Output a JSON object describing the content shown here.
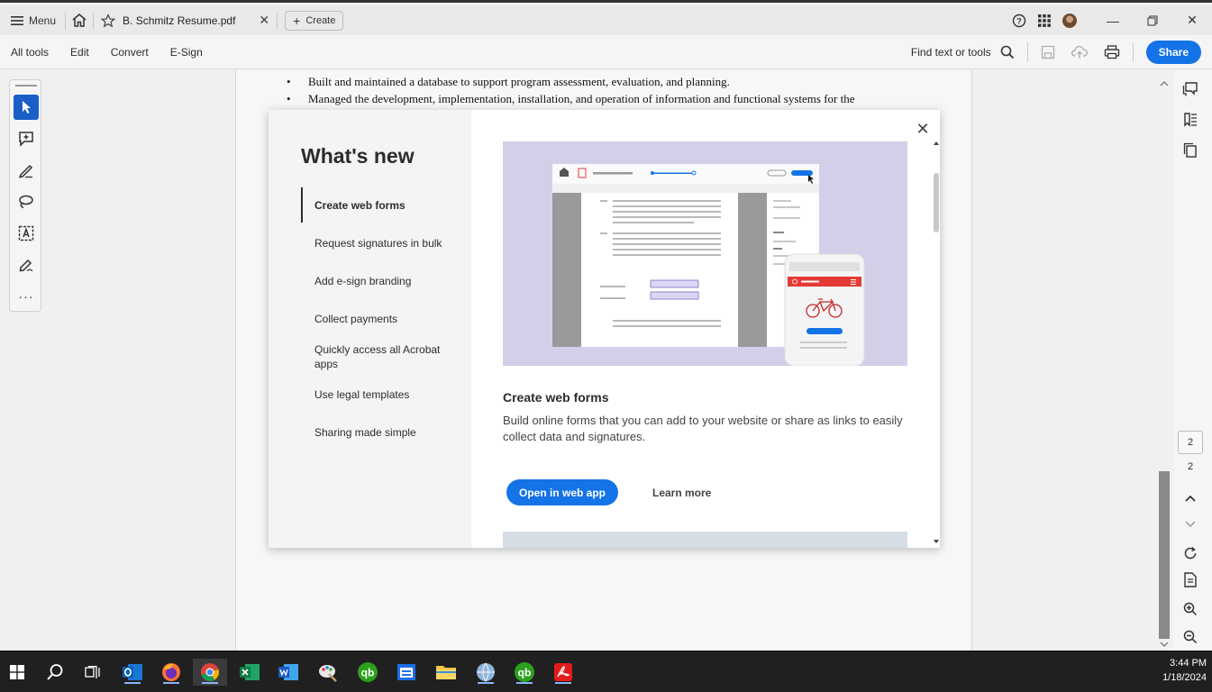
{
  "titlebar": {
    "menu_label": "Menu",
    "tab_title": "B. Schmitz Resume.pdf",
    "create_label": "Create"
  },
  "toolbar": {
    "items": [
      "All tools",
      "Edit",
      "Convert",
      "E-Sign"
    ],
    "find_label": "Find text or tools",
    "share_label": "Share"
  },
  "document": {
    "bullets": [
      "Built and maintained a database to support program assessment, evaluation, and planning.",
      "Managed the development, implementation, installation, and operation of information and functional systems for the"
    ]
  },
  "right_rail": {
    "current_page": "2",
    "total_pages": "2"
  },
  "modal": {
    "title": "What's new",
    "nav_items": [
      "Create web forms",
      "Request signatures in bulk",
      "Add e-sign branding",
      "Collect payments",
      "Quickly access all Acrobat apps",
      "Use legal templates",
      "Sharing made simple"
    ],
    "active_index": 0,
    "content_title": "Create web forms",
    "content_desc": "Build online forms that you can add to your website or share as links to easily collect data and signatures.",
    "primary_button": "Open in web app",
    "secondary_link": "Learn more"
  },
  "taskbar": {
    "time": "3:44 PM",
    "date": "1/18/2024"
  },
  "colors": {
    "accent": "#1473e6",
    "hero_bg": "#d4cfe9",
    "active_tool": "#1a5fc8"
  }
}
